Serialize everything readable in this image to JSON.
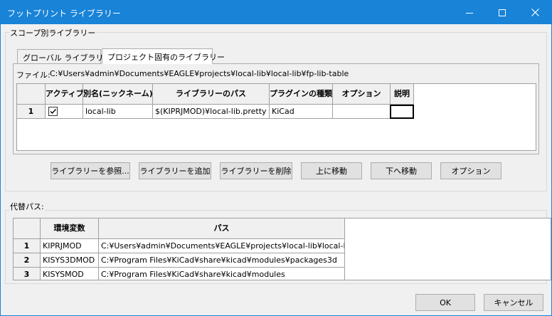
{
  "window": {
    "title": "フットプリント ライブラリー"
  },
  "scope_group": {
    "label": "スコープ別ライブラリー",
    "tabs": [
      {
        "label": "グローバル ライブラリー",
        "active": false
      },
      {
        "label": "プロジェクト固有のライブラリー",
        "active": true
      }
    ],
    "file_label": "ファイル:",
    "file_path": "C:¥Users¥admin¥Documents¥EAGLE¥projects¥local-lib¥local-lib¥fp-lib-table",
    "table": {
      "headers": [
        "アクティブ",
        "別名(ニックネーム)",
        "ライブラリーのパス",
        "プラグインの種類",
        "オプション",
        "説明"
      ],
      "rows": [
        {
          "num": "1",
          "active": true,
          "nickname": "local-lib",
          "path": "$(KIPRJMOD)¥local-lib.pretty",
          "plugin": "KiCad",
          "options": "",
          "description": ""
        }
      ]
    },
    "buttons": {
      "browse": "ライブラリーを参照...",
      "add": "ライブラリーを追加",
      "remove": "ライブラリーを削除",
      "move_up": "上に移動",
      "move_down": "下へ移動",
      "options": "オプション"
    }
  },
  "path_group": {
    "label": "代替パス:",
    "table": {
      "headers": [
        "環境変数",
        "パス"
      ],
      "rows": [
        {
          "num": "1",
          "name": "KIPRJMOD",
          "path": "C:¥Users¥admin¥Documents¥EAGLE¥projects¥local-lib¥local-lib"
        },
        {
          "num": "2",
          "name": "KISYS3DMOD",
          "path": "C:¥Program Files¥KiCad¥share¥kicad¥modules¥packages3d"
        },
        {
          "num": "3",
          "name": "KISYSMOD",
          "path": "C:¥Program Files¥KiCad¥share¥kicad¥modules"
        }
      ]
    }
  },
  "footer": {
    "ok": "OK",
    "cancel": "キャンセル"
  }
}
